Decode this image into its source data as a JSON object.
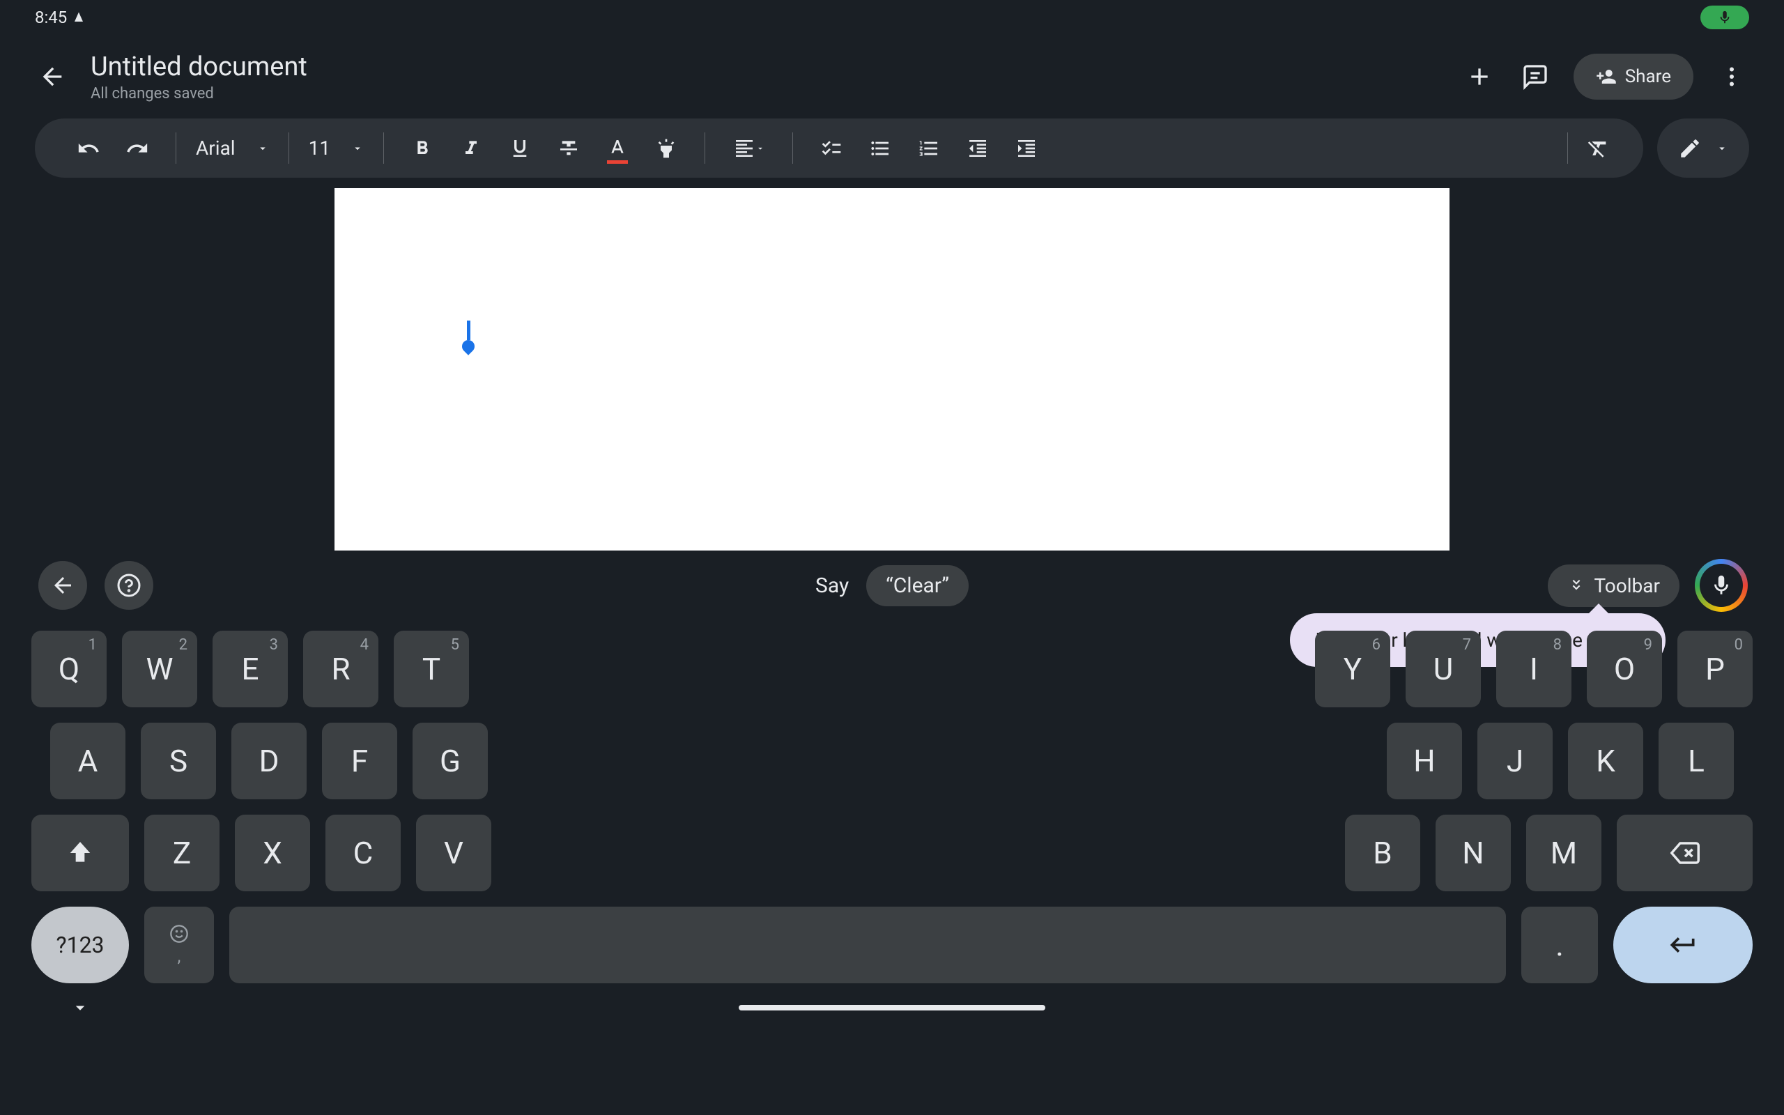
{
  "status": {
    "time": "8:45"
  },
  "header": {
    "title": "Untitled document",
    "save_status": "All changes saved",
    "share_label": "Share"
  },
  "toolbar": {
    "font_family": "Arial",
    "font_size": "11"
  },
  "voice": {
    "say_label": "Say",
    "clear_chip": "“Clear”",
    "toolbar_label": "Toolbar",
    "tooltip": "Hide your keyboard while voice typing"
  },
  "keyboard": {
    "row1": [
      {
        "main": "Q",
        "hint": "1"
      },
      {
        "main": "W",
        "hint": "2"
      },
      {
        "main": "E",
        "hint": "3"
      },
      {
        "main": "R",
        "hint": "4"
      },
      {
        "main": "T",
        "hint": "5"
      },
      {
        "main": "Y",
        "hint": "6"
      },
      {
        "main": "U",
        "hint": "7"
      },
      {
        "main": "I",
        "hint": "8"
      },
      {
        "main": "O",
        "hint": "9"
      },
      {
        "main": "P",
        "hint": "0"
      }
    ],
    "row2": [
      "A",
      "S",
      "D",
      "F",
      "G",
      "H",
      "J",
      "K",
      "L"
    ],
    "row3": [
      "Z",
      "X",
      "C",
      "V",
      "B",
      "N",
      "M"
    ],
    "symbols_label": "?123",
    "comma": ",",
    "period": "."
  }
}
